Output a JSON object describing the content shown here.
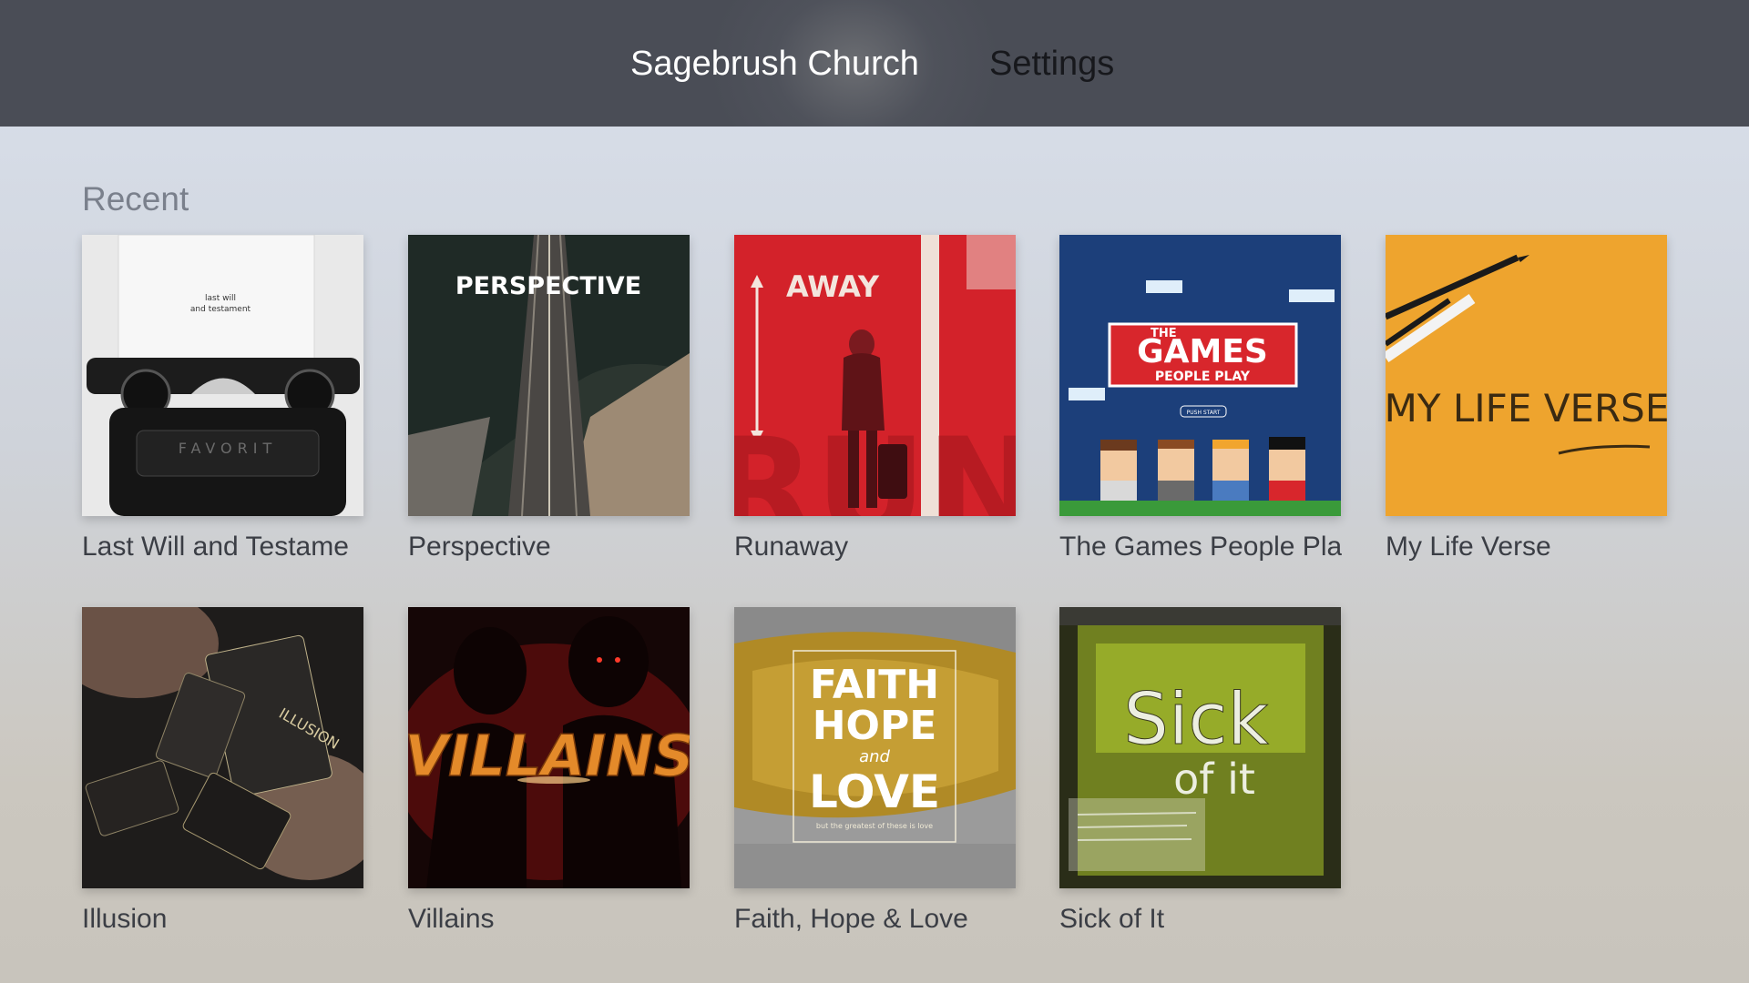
{
  "nav": {
    "app_title": "Sagebrush Church",
    "settings_label": "Settings"
  },
  "section": {
    "title": "Recent"
  },
  "items": [
    {
      "title": "Last Will and Testament",
      "caption": "Last Will and Testame",
      "art_text": [
        "last will",
        "and testament",
        "FAVORIT"
      ]
    },
    {
      "title": "Perspective",
      "caption": "Perspective",
      "art_text": [
        "PERSPECTIVE"
      ]
    },
    {
      "title": "Runaway",
      "caption": "Runaway",
      "art_text": [
        "AWAY",
        "RUN"
      ]
    },
    {
      "title": "The Games People Play",
      "caption": "The Games People Pla",
      "art_text": [
        "THE",
        "GAMES",
        "PEOPLE PLAY",
        "PUSH START"
      ]
    },
    {
      "title": "My Life Verse",
      "caption": "My Life Verse",
      "art_text": [
        "MY LIFE VERSE"
      ]
    },
    {
      "title": "Illusion",
      "caption": "Illusion",
      "art_text": [
        "ILLUSION"
      ]
    },
    {
      "title": "Villains",
      "caption": "Villains",
      "art_text": [
        "VILLAINS"
      ]
    },
    {
      "title": "Faith, Hope & Love",
      "caption": "Faith, Hope & Love",
      "art_text": [
        "FAITH",
        "HOPE",
        "and",
        "LOVE",
        "but the greatest of these is love"
      ]
    },
    {
      "title": "Sick of It",
      "caption": "Sick of It",
      "art_text": [
        "Sick",
        "of it"
      ]
    }
  ],
  "colors": {
    "nav_bg": "#4c4f58",
    "nav_active": "#ffffff",
    "nav_inactive": "#17181c",
    "section_title": "#7a808c",
    "caption": "#3b3e45"
  }
}
